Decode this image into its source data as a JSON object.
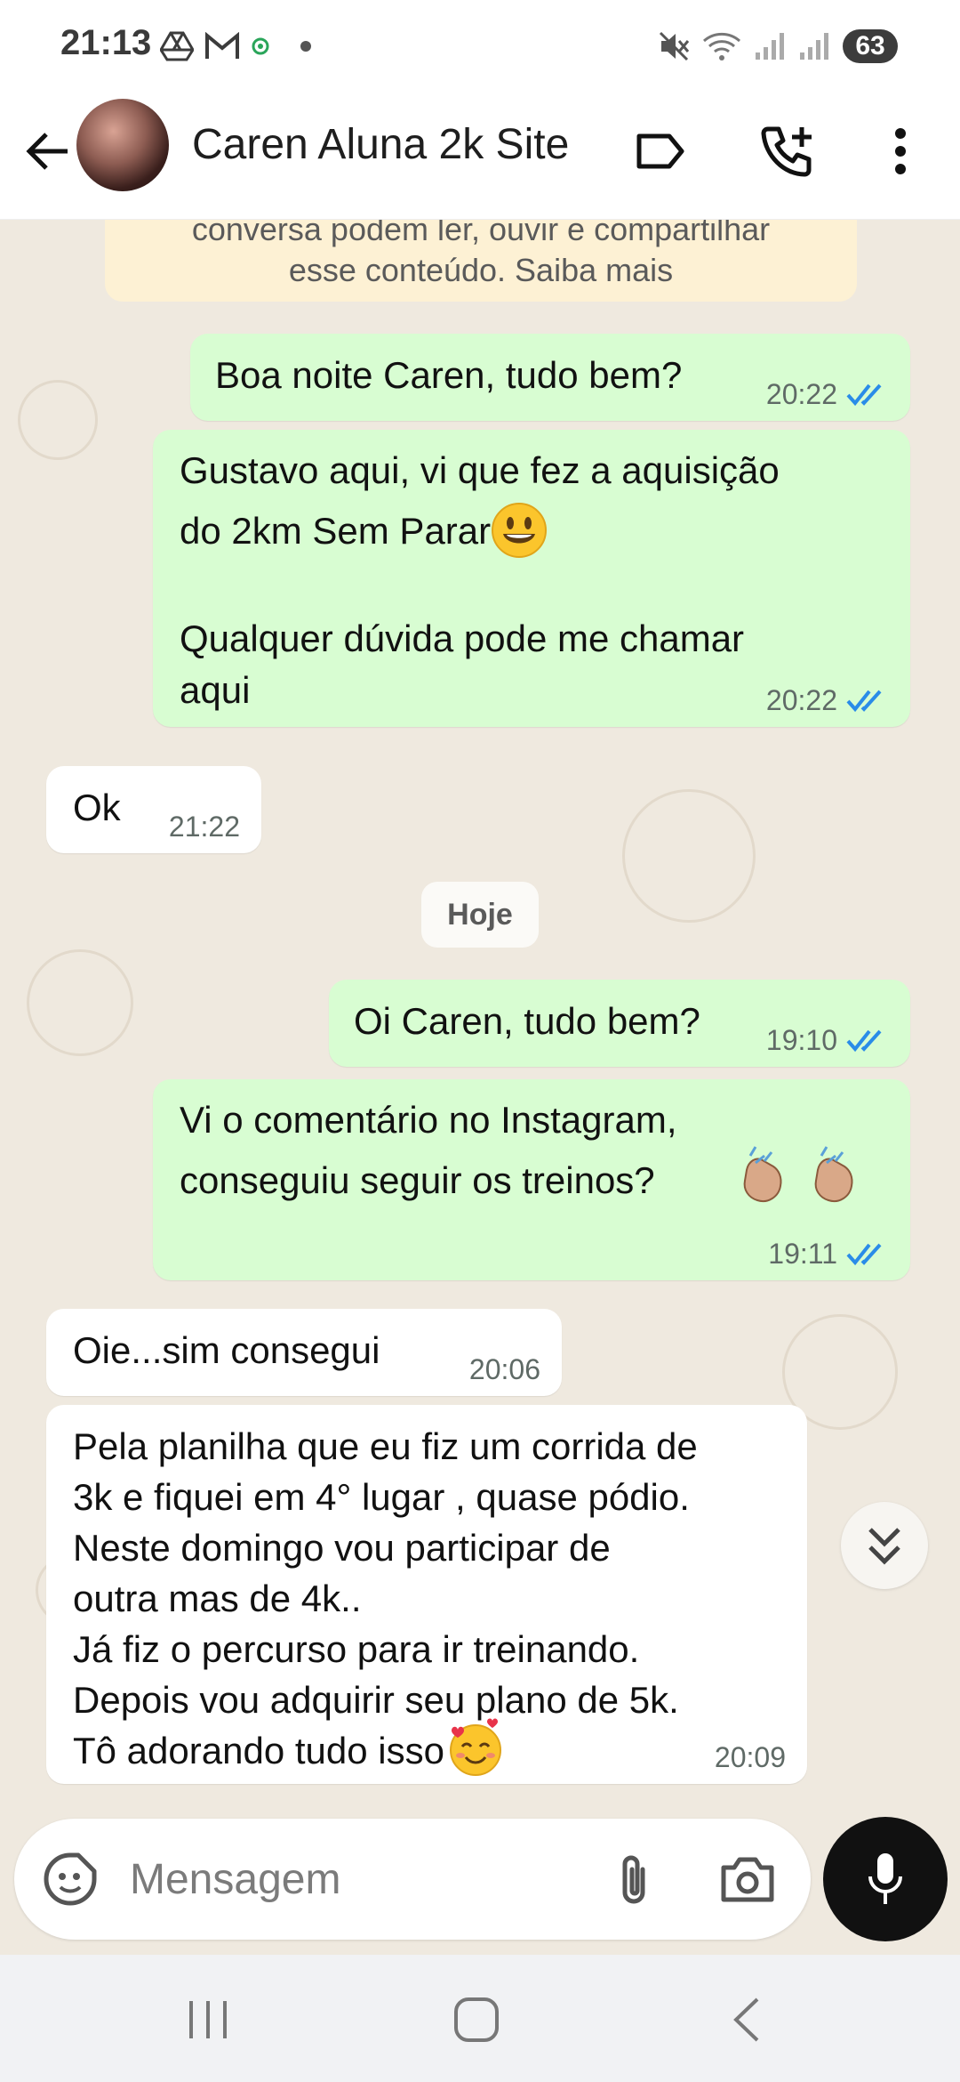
{
  "status_bar": {
    "time": "21:13",
    "battery": "63"
  },
  "header": {
    "contact_name": "Caren Aluna 2k Site"
  },
  "notice": {
    "line1": "conversa podem ler, ouvir e compartilhar",
    "line2": "esse conteúdo. Saiba mais"
  },
  "messages": [
    {
      "direction": "out",
      "text": "Boa noite Caren, tudo bem?",
      "time": "20:22",
      "status": "read"
    },
    {
      "direction": "out",
      "text": "Gustavo aqui, vi que fez a aquisição\ndo 2km Sem Parar",
      "text2": "Qualquer dúvida pode me chamar\naqui",
      "time": "20:22",
      "status": "read"
    },
    {
      "direction": "in",
      "text": "Ok",
      "time": "21:22"
    },
    {
      "direction": "out",
      "text": "Oi Caren, tudo bem?",
      "time": "19:10",
      "status": "read"
    },
    {
      "direction": "out",
      "text": "Vi o comentário no Instagram,\nconseguiu seguir os treinos?",
      "time": "19:11",
      "status": "read"
    },
    {
      "direction": "in",
      "text": "Oie...sim consegui",
      "time": "20:06"
    },
    {
      "direction": "in",
      "text": "Pela planilha que eu fiz um corrida de\n3k e fiquei em 4° lugar , quase pódio.\nNeste domingo vou participar de\noutra mas de 4k..\nJá fiz o percurso para ir treinando.\nDepois vou adquirir seu plano de 5k.\nTô adorando tudo isso",
      "time": "20:09"
    }
  ],
  "date_separator": "Hoje",
  "composer": {
    "placeholder": "Mensagem"
  },
  "colors": {
    "outgoing_bubble": "#d8fdd2",
    "incoming_bubble": "#ffffff",
    "chat_background": "#efe9df",
    "read_ticks": "#2a8ce8",
    "mic_button": "#111111"
  },
  "icons": [
    "back-arrow-icon",
    "label-icon",
    "add-call-icon",
    "more-vert-icon",
    "sticker-icon",
    "attach-icon",
    "camera-icon",
    "mic-icon",
    "double-chevron-down-icon",
    "recent-apps-icon",
    "home-icon",
    "nav-back-icon"
  ]
}
